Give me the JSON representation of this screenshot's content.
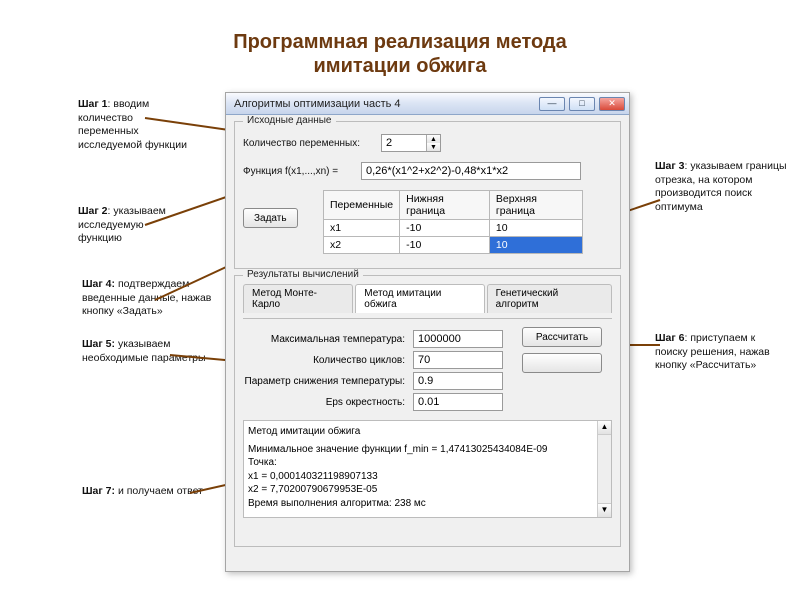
{
  "title_line1": "Программная реализация метода",
  "title_line2": "имитации обжига",
  "steps": {
    "s1": {
      "h": "Шаг 1",
      "t": ": вводим количество переменных исследуемой функции"
    },
    "s2": {
      "h": "Шаг 2",
      "t": ": указываем исследуемую функцию"
    },
    "s3": {
      "h": "Шаг 3",
      "t": ": указываем границы отрезка, на котором производится поиск оптимума"
    },
    "s4": {
      "h": "Шаг 4:",
      "t": " подтверждаем введенные данные, нажав кнопку «Задать»"
    },
    "s5": {
      "h": "Шаг 5:",
      "t": "  указываем необходимые параметры"
    },
    "s6": {
      "h": "Шаг 6",
      "t": ": приступаем к поиску решения, нажав кнопку «Рассчитать»"
    },
    "s7": {
      "h": "Шаг 7:",
      "t": "  и получаем ответ"
    }
  },
  "window": {
    "title": "Алгоритмы оптимизации часть 4",
    "groupbox1": "Исходные данные",
    "varcount_label": "Количество переменных:",
    "varcount_value": "2",
    "func_label": "Функция f(x1,...,xn) =",
    "func_value": "0,26*(x1^2+x2^2)-0,48*x1*x2",
    "table": {
      "headers": [
        "Переменные",
        "Нижняя граница",
        "Верхняя граница"
      ],
      "rows": [
        {
          "v": "x1",
          "lo": "-10",
          "hi": "10"
        },
        {
          "v": "x2",
          "lo": "-10",
          "hi": "10"
        }
      ]
    },
    "set_btn": "Задать",
    "groupbox2": "Результаты вычислений",
    "tabs": [
      "Метод Монте-Карло",
      "Метод имитации обжига",
      "Генетический алгоритм"
    ],
    "params": {
      "maxT_label": "Максимальная температура:",
      "maxT": "1000000",
      "cycles_label": "Количество циклов:",
      "cycles": "70",
      "cool_label": "Параметр снижения температуры:",
      "cool": "0.9",
      "eps_label": "Eps окрестность:",
      "eps": "0.01"
    },
    "calc_btn": "Рассчитать",
    "output": {
      "l1": "Метод имитации обжига",
      "l2": "Минимальное значение функции f_min = 1,47413025434084E-09",
      "l3": "Точка:",
      "l4": "x1 = 0,000140321198907133",
      "l5": "x2 = 7,70200790679953E-05",
      "l6": "Время выполнения алгоритма: 238 мс"
    }
  }
}
